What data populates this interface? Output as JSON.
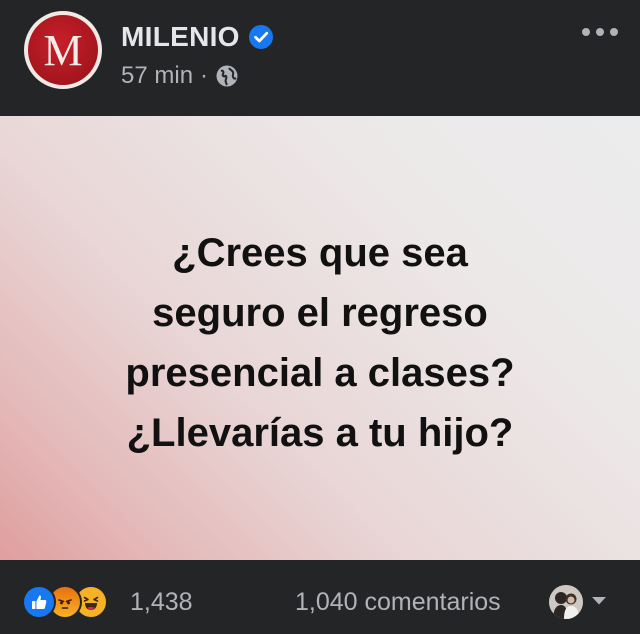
{
  "post": {
    "page_name": "MILENIO",
    "avatar_letter": "M",
    "time": "57 min",
    "separator": "·",
    "privacy_icon": "globe-icon",
    "verified_icon": "verified-badge-icon",
    "more_icon": "more-options-icon"
  },
  "content": {
    "lines": [
      "¿Crees que sea",
      "seguro el regreso",
      "presencial a clases?",
      "¿Llevarías a tu hijo?"
    ]
  },
  "footer": {
    "reactions": [
      "like-icon",
      "angry-icon",
      "haha-icon"
    ],
    "reaction_count": "1,438",
    "comment_count": "1,040 comentarios"
  },
  "colors": {
    "background": "#242526",
    "text_primary": "#e4e6eb",
    "text_secondary": "#b0b3b8",
    "brand_red": "#c8202a",
    "verified_blue": "#1877f2",
    "gradient_light": "#ececec",
    "gradient_pink": "#df9e9f"
  }
}
